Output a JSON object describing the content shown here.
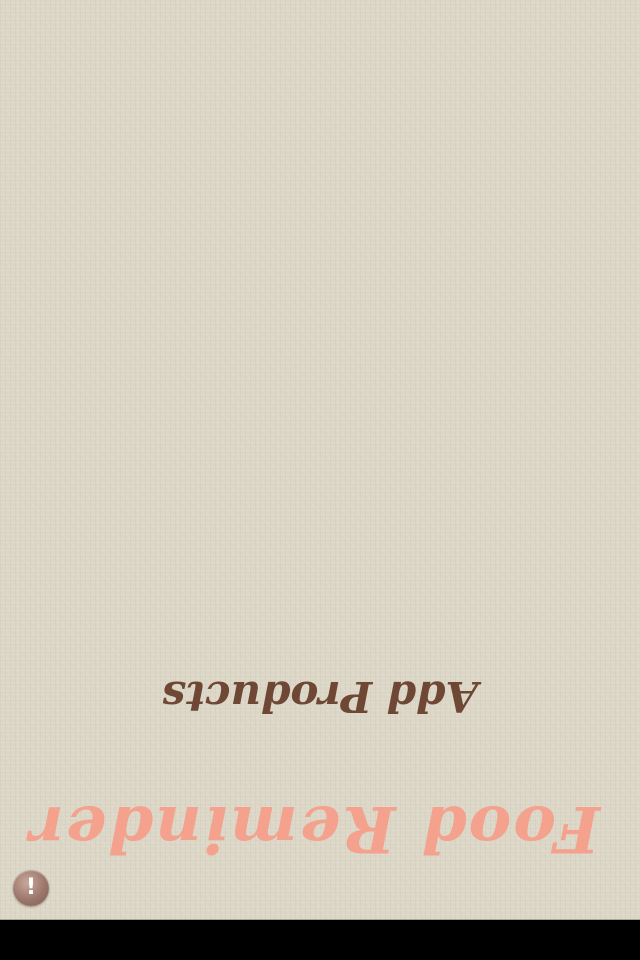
{
  "app": {
    "title": "Food Reminder",
    "title_color": "#f4a18d"
  },
  "actions": {
    "add_products_label": "Add Products",
    "add_products_color": "#6e4735"
  },
  "info_button": {
    "icon": "exclamation-icon",
    "glyph": "!"
  },
  "theme": {
    "background": "#dcd6c6",
    "bottom_bar": "#000000",
    "orientation": "upside-down"
  }
}
